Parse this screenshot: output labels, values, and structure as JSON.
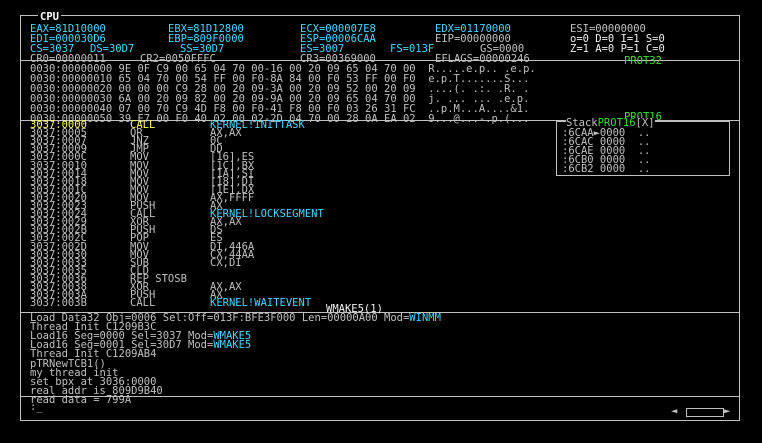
{
  "window_title": "CPU",
  "registers": {
    "row1": [
      "EAX=81D10000",
      "EBX=81D12800",
      "ECX=000007E8",
      "EDX=01170000",
      "ESI=00000000"
    ],
    "row2": [
      "EDI=000030D6",
      "EBP=809F0000",
      "ESP=00006CAA",
      "EIP=00000000",
      "o=0 D=0 I=1 S=0"
    ],
    "row3": [
      "CS=3037",
      "DS=30D7",
      "SS=30D7",
      "ES=3007",
      "FS=013F",
      "GS=0000",
      "Z=1 A=0 P=1 C=0"
    ],
    "row4": [
      "CR0=00000011",
      "CR2=0050FFFC",
      "CR3=00369000",
      "EFLAGS=00000246"
    ]
  },
  "prot32_label": "PROT32",
  "memory": [
    "0030:00000000 9E 0F C9 00 65 04 70 00-16 00 20 09 65 04 70 00  R.....e.p.. .e.p.",
    "0030:00000010 65 04 70 00 54 FF 00 F0-8A 84 00 F0 53 FF 00 F0  e.p.T.......S...",
    "0030:00000020 00 00 00 C9 28 00 20 09-3A 00 20 09 52 00 20 09  ....(. .:. .R. .",
    "0030:00000030 6A 00 20 09 82 00 20 09-9A 00 20 09 65 04 70 00  j. ... ... .e.p.",
    "0030:00000040 07 00 70 C9 4D F8 00 F0-41 F8 00 F0 03 26 31 FC  ..p.M...A....&1.",
    "0030:00000050 39 E7 00 F0 40 02 00 02-2D 04 70 00 28 0A EA 02  9...@...-.p.(..."
  ],
  "prot16_label": "PROT16",
  "code": [
    {
      "addr": "3037:0000",
      "mnem": "CALL",
      "ops": "KERNEL!INITTASK",
      "op_highlight": true,
      "current": true
    },
    {
      "addr": "3037:0005",
      "mnem": "OR",
      "ops": "AX,AX"
    },
    {
      "addr": "3037:0007",
      "mnem": "JNZ",
      "ops": "0C"
    },
    {
      "addr": "3037:0009",
      "mnem": "JMP",
      "ops": "DD"
    },
    {
      "addr": "3037:000C",
      "mnem": "MOV",
      "ops": "[16],ES"
    },
    {
      "addr": "3037:0010",
      "mnem": "MOV",
      "ops": "[1C],BX"
    },
    {
      "addr": "3037:0014",
      "mnem": "MOV",
      "ops": "[1A],SI"
    },
    {
      "addr": "3037:0018",
      "mnem": "MOV",
      "ops": "[18],DI"
    },
    {
      "addr": "3037:001C",
      "mnem": "MOV",
      "ops": "[1E],DX"
    },
    {
      "addr": "3037:0020",
      "mnem": "MOV",
      "ops": "AX,FFFF"
    },
    {
      "addr": "3037:0023",
      "mnem": "PUSH",
      "ops": "AX"
    },
    {
      "addr": "3037:0024",
      "mnem": "CALL",
      "ops": "KERNEL!LOCKSEGMENT",
      "op_highlight": true
    },
    {
      "addr": "3037:0029",
      "mnem": "XOR",
      "ops": "AX,AX"
    },
    {
      "addr": "3037:002B",
      "mnem": "PUSH",
      "ops": "DS"
    },
    {
      "addr": "3037:002C",
      "mnem": "POP",
      "ops": "ES"
    },
    {
      "addr": "3037:002D",
      "mnem": "MOV",
      "ops": "DI,446A"
    },
    {
      "addr": "3037:0030",
      "mnem": "MOV",
      "ops": "CX,44AA"
    },
    {
      "addr": "3037:0033",
      "mnem": "SUB",
      "ops": "CX,DI"
    },
    {
      "addr": "3037:0035",
      "mnem": "CLD",
      "ops": ""
    },
    {
      "addr": "3037:0036",
      "mnem": "REP STOSB",
      "ops": ""
    },
    {
      "addr": "3037:0038",
      "mnem": "XOR",
      "ops": "AX,AX"
    },
    {
      "addr": "3037:003A",
      "mnem": "PUSH",
      "ops": "AX"
    },
    {
      "addr": "3037:003B",
      "mnem": "CALL",
      "ops": "KERNEL!WAITEVENT",
      "op_highlight": true
    }
  ],
  "code_footer": "WMAKE5(1)",
  "stack": {
    "title": "Stack",
    "prot_label": "PROT16",
    "close_label": "[X]",
    "rows": [
      {
        "addr": ":6CAA",
        "val": "0000",
        "chars": ".."
      },
      {
        "addr": ":6CAC",
        "val": "0000",
        "chars": ".."
      },
      {
        "addr": ":6CAE",
        "val": "0000",
        "chars": ".."
      },
      {
        "addr": ":6CB0",
        "val": "0000",
        "chars": ".."
      },
      {
        "addr": ":6CB2",
        "val": "0000",
        "chars": ".."
      }
    ]
  },
  "log": [
    [
      {
        "t": "Load Data32 Obj=0006 Sel:Off=013F:BFE3F000 Len=00000A00 Mod="
      },
      {
        "t": "WINMM",
        "c": "cyan"
      }
    ],
    [
      {
        "t": "Thread Init C1209B3C"
      }
    ],
    [
      {
        "t": "Load16 Seg=0000 Sel=3037 Mod="
      },
      {
        "t": "WMAKE5",
        "c": "cyan"
      }
    ],
    [
      {
        "t": "Load16 Seg=0001 Sel=30D7 Mod="
      },
      {
        "t": "WMAKE5",
        "c": "cyan"
      }
    ],
    [
      {
        "t": "Thread Init C1209AB4"
      }
    ],
    [
      {
        "t": "pTRNewTCB1()"
      }
    ],
    [
      {
        "t": "my thread init"
      }
    ],
    [
      {
        "t": "set bpx at 3036:0000"
      }
    ],
    [
      {
        "t": "real addr is 809D9B40"
      }
    ],
    [
      {
        "t": "read data = 799A"
      }
    ]
  ],
  "command_prompt": ":_"
}
